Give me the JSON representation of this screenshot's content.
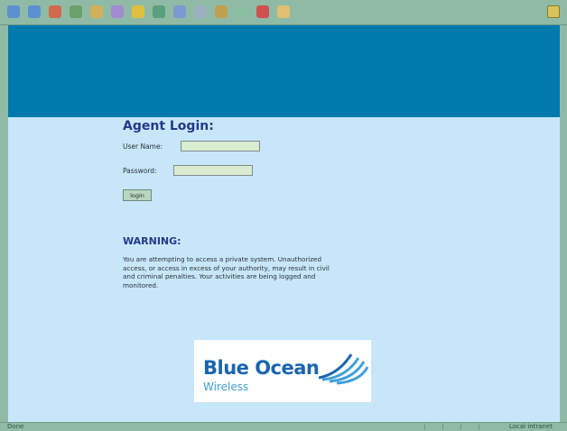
{
  "toolbar": {
    "buttons": [
      {
        "name": "back-icon",
        "color": "#5a8fd0"
      },
      {
        "name": "forward-icon",
        "color": "#5a8fd0"
      },
      {
        "name": "stop-icon",
        "color": "#d06a4a"
      },
      {
        "name": "refresh-icon",
        "color": "#6aa06a"
      },
      {
        "name": "home-icon",
        "color": "#d0b05a"
      },
      {
        "name": "search-icon",
        "color": "#a08ad0"
      },
      {
        "name": "favorites-icon",
        "color": "#e0c040"
      },
      {
        "name": "history-icon",
        "color": "#5aa07a"
      },
      {
        "name": "mail-icon",
        "color": "#7a9ad0"
      },
      {
        "name": "print-icon",
        "color": "#9ab0c0"
      },
      {
        "name": "edit-icon",
        "color": "#c0a050"
      },
      {
        "name": "discuss-icon",
        "color": "#8ac0a0"
      },
      {
        "name": "messenger-icon",
        "color": "#d05050"
      },
      {
        "name": "folder-icon",
        "color": "#e0c070"
      }
    ]
  },
  "login": {
    "title": "Agent Login:",
    "username_label": "User Name:",
    "username_value": "",
    "password_label": "Password:",
    "password_value": "",
    "button_label": "login"
  },
  "warning": {
    "title": "WARNING:",
    "text": "You are attempting to access a private system. Unauthorized access, or access in excess of your authority, may result in civil and criminal penalties. Your activities are being logged and monitored."
  },
  "logo": {
    "name": "Blue Ocean",
    "subtitle": "Wireless"
  },
  "status": {
    "left": "Done",
    "right": "Local intranet"
  },
  "colors": {
    "banner": "#0079ad",
    "background": "#c8e6fa",
    "heading": "#203a88"
  }
}
